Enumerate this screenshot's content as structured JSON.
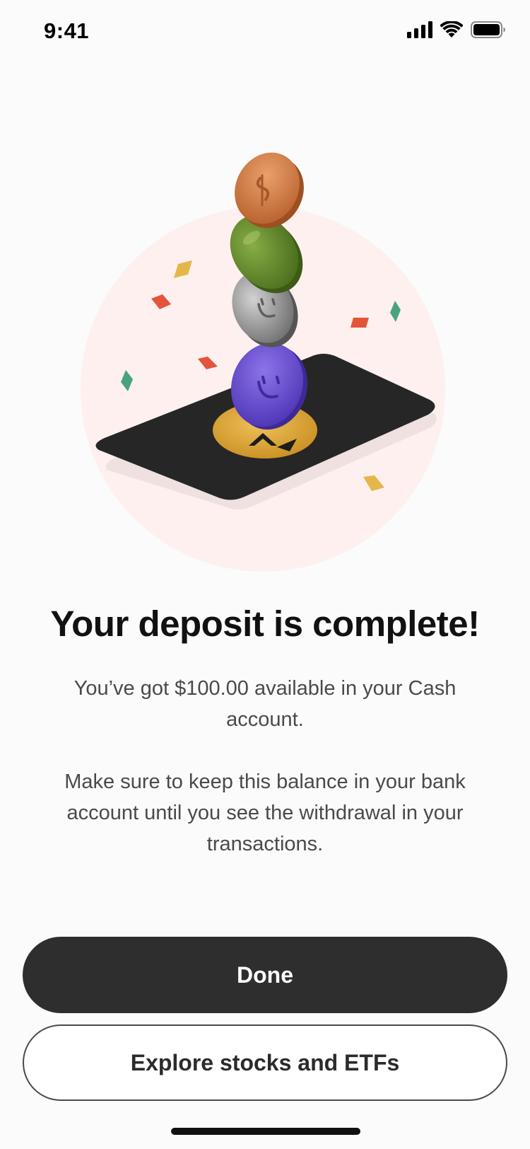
{
  "status_bar": {
    "time": "9:41",
    "icons": [
      "cellular-signal-icon",
      "wifi-icon",
      "battery-icon"
    ]
  },
  "hero": {
    "illustration": "coin-stack-deposit-illustration",
    "colors": {
      "backdrop_circle": "#fdf0ee",
      "card": "#262626",
      "gold_disc": "#e0a93a",
      "coin_copper": "#d8854a",
      "coin_green": "#5f8a2c",
      "coin_silver": "#9b9b9b",
      "coin_purple": "#6a4fd0",
      "confetti_yellow": "#e5b64a",
      "confetti_red": "#e3553a",
      "confetti_green": "#4aa37f"
    }
  },
  "main": {
    "title": "Your deposit is complete!",
    "message_1": "You’ve got $100.00 available in your Cash account.",
    "message_2": "Make sure to keep this balance in your bank account until you see the withdrawal in your transactions."
  },
  "actions": {
    "primary_label": "Done",
    "secondary_label": "Explore stocks and ETFs"
  },
  "colors": {
    "background": "#fbfbfb",
    "primary_button": "#2e2e2e",
    "primary_text": "#ffffff",
    "secondary_border": "#4a4a4a",
    "body_text": "#4a4a4a"
  }
}
